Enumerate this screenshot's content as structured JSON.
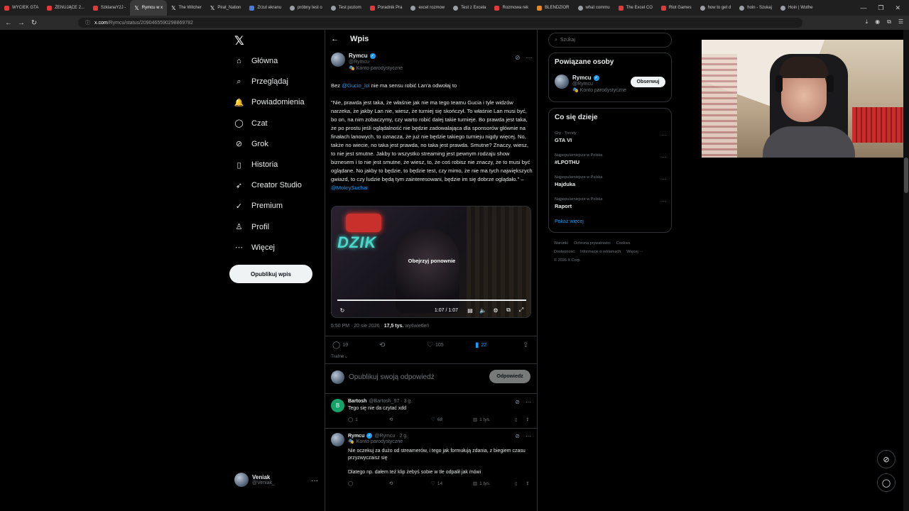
{
  "browser": {
    "tabs": [
      {
        "label": "WYCIEK GTA",
        "fav": "r"
      },
      {
        "label": "ŻENUJĄCE 2...",
        "fav": "r"
      },
      {
        "label": "SzklanaY2J -",
        "fav": "r"
      },
      {
        "label": "Rymcu w x",
        "fav": "x"
      },
      {
        "label": "The Witcher",
        "fav": "x"
      },
      {
        "label": "Pirat_Nation",
        "fav": "x"
      },
      {
        "label": "Zrzut ekranu",
        "fav": "b"
      },
      {
        "label": "próbny test o",
        "fav": "g"
      },
      {
        "label": "Test poziom",
        "fav": "g"
      },
      {
        "label": "Poradnik Pra",
        "fav": "r"
      },
      {
        "label": "excel rozmow",
        "fav": "g"
      },
      {
        "label": "Test z Excela",
        "fav": "g"
      },
      {
        "label": "Rozmowa rek",
        "fav": "r"
      },
      {
        "label": "BLENDZIOR",
        "fav": "o"
      },
      {
        "label": "what commu",
        "fav": "g"
      },
      {
        "label": "The Excel CO",
        "fav": "r"
      },
      {
        "label": "Riot Games",
        "fav": "r"
      },
      {
        "label": "how to get d",
        "fav": "g"
      },
      {
        "label": "hoin - Szukaj",
        "fav": "g"
      },
      {
        "label": "Hoin | Wuthe",
        "fav": "g"
      }
    ],
    "url_host": "x.com",
    "url_path": "/Rymcu/status/2090465590298869782"
  },
  "nav": {
    "items": [
      {
        "label": "Główna",
        "icon": "home-icon"
      },
      {
        "label": "Przeglądaj",
        "icon": "search-icon"
      },
      {
        "label": "Powiadomienia",
        "icon": "bell-icon"
      },
      {
        "label": "Czat",
        "icon": "chat-icon"
      },
      {
        "label": "Grok",
        "icon": "grok-icon"
      },
      {
        "label": "Historia",
        "icon": "bookmark-icon"
      },
      {
        "label": "Creator Studio",
        "icon": "rocket-icon"
      },
      {
        "label": "Premium",
        "icon": "check-circle-icon"
      },
      {
        "label": "Profil",
        "icon": "person-icon"
      },
      {
        "label": "Więcej",
        "icon": "more-circle-icon"
      }
    ],
    "post_button": "Opublikuj wpis",
    "me": {
      "name": "Veniak",
      "handle": "@Veniak_"
    }
  },
  "header": {
    "title": "Wpis"
  },
  "post": {
    "author": {
      "name": "Rymcu",
      "handle": "@Rymcu",
      "parody": "Konto parodystyczne"
    },
    "intro_pre": "Bez ",
    "intro_mention": "@Gucio_lol",
    "intro_post": " nie ma sensu robić Lan'a odwołaj to",
    "quote": "\"Nie, prawda jest taka, że właśnie jak nie ma tego teamu Gucia i tyle widzów narzeka, że jakby Lan nie, wiesz, że turniej się skończył. To właśnie Lan musi być, bo on, na nim zobaczymy, czy warto robić dalej takie turnieje. Bo prawda jest taka, że po prostu jeśli oglądalność nie będzie zadowalająca dla sponsorów głównie na finałach lanowych, to oznacza, że już nie będzie takiego turnieju nigdy więcej. No, także no wiecie, no taka jest prawda, no taka jest prawda. Smutne? Znaczy, wiesz, to nie jest smutne. Jakby to wszystko streaming jest pewnym rodzaju show biznesem i to nie jest smutne, że wiesz, to, że coś robisz nie znaczy, że to musi być oglądane. No jakby to będzie, to będzie test, czy mimo, że nie ma tych największych gwiazd, to czy ludzie będą tym zainteresowani, będzie im się dobrze oglądało.\" – ",
    "quote_mention": "@MokrySuchar",
    "video": {
      "replay_label": "Obejrzyj ponownie",
      "time": "1:07 / 1:07",
      "neon_text": "DZIK",
      "progress": 1.0
    },
    "meta_time": "5:50 PM · 20 sie 2026 · ",
    "meta_views": "17,5 tys.",
    "meta_views_label": " wyświetleń",
    "stats": {
      "replies": "19",
      "reposts": "",
      "likes": "105",
      "bookmarks": "22"
    },
    "sort_label": "Trafne"
  },
  "compose": {
    "placeholder": "Opublikuj swoją odpowiedź",
    "button": "Odpowiedz"
  },
  "replies": [
    {
      "avatar_letter": "B",
      "name": "Bartosh",
      "handle": "@Bartosh_97 · 3 g.",
      "parody": "",
      "text": "Tego się nie da czytać xdd",
      "text2": "",
      "replies": "1",
      "reposts": "",
      "likes": "68",
      "views": "1 tys."
    },
    {
      "avatar_letter": "",
      "name": "Rymcu",
      "handle": "@Rymcu · 2 g.",
      "parody": "Konto parodystyczne",
      "text": "Nie oczekuj za dużo od streamerów, i tego jak formułują zdania, z biegiem czasu przyzwyczaisz się",
      "text2": "Dlatego np. dałem też klip żebyś sobie w tle odpalił jak mówi",
      "replies": "",
      "reposts": "",
      "likes": "14",
      "views": "1 tys."
    }
  ],
  "right": {
    "search_placeholder": "Szukaj",
    "related_title": "Powiązane osoby",
    "related": {
      "name": "Rymcu",
      "handle": "@Rymcu",
      "parody": "Konto parodystyczne",
      "follow": "Obserwuj"
    },
    "trends_title": "Co się dzieje",
    "trends": [
      {
        "category": "Gry · Trendy",
        "name": "GTA VI"
      },
      {
        "category": "Najpopularniejsze w Polska",
        "name": "#LPOTHU"
      },
      {
        "category": "Najpopularniejsze w Polska",
        "name": "Hajduka"
      },
      {
        "category": "Najpopularniejsze w Polska",
        "name": "Raport"
      }
    ],
    "show_more": "Pokaż więcej",
    "footer": [
      "Warunki",
      "Ochrona prywatności",
      "Cookies",
      "Dostępność",
      "Informacje o reklamach",
      "Więcej ···",
      "© 2026 X Corp."
    ]
  }
}
